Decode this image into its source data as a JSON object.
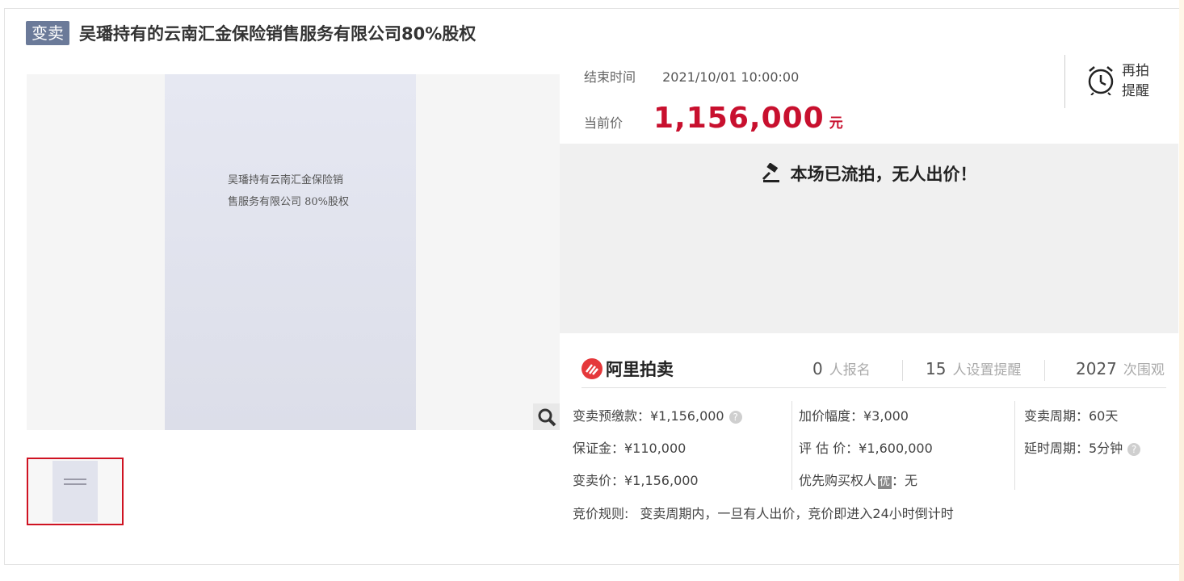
{
  "header": {
    "badge": "变卖",
    "title": "吴璠持有的云南汇金保险销售服务有限公司80%股权"
  },
  "gallery": {
    "doc_line1": "吴璠持有云南汇金保险销",
    "doc_line2": "售服务有限公司 80%股权",
    "zoom_icon": "magnifier-icon"
  },
  "auction": {
    "end_label": "结束时间",
    "end_value": "2021/10/01 10:00:00",
    "price_label": "当前价",
    "price_value": "1,156,000",
    "price_unit": "元",
    "remind_line1": "再拍",
    "remind_line2": "提醒",
    "remind_icon": "alarm-clock-icon",
    "status_text": "本场已流拍，无人出价！",
    "status_icon": "gavel-icon",
    "accent_color": "#c8102e"
  },
  "stats": {
    "logo_text": "阿里拍卖",
    "signups_num": "0",
    "signups_label": "人报名",
    "reminders_num": "15",
    "reminders_label": "人设置提醒",
    "views_num": "2027",
    "views_label": "次围观"
  },
  "details": {
    "col1": [
      "变卖预缴款：¥1,156,000",
      "保证金：¥110,000",
      "变卖价：¥1,156,000"
    ],
    "col2": [
      "加价幅度：¥3,000",
      "评 估 价：¥1,600,000",
      "优先购买权人"
    ],
    "col2_you": "优",
    "col2_you_value": "：无",
    "col3": [
      "变卖周期：60天",
      "延时周期：5分钟"
    ],
    "help_mark": "?",
    "rule_label": "竞价规则:",
    "rule_text": "变卖周期内，一旦有人出价，竞价即进入24小时倒计时"
  }
}
